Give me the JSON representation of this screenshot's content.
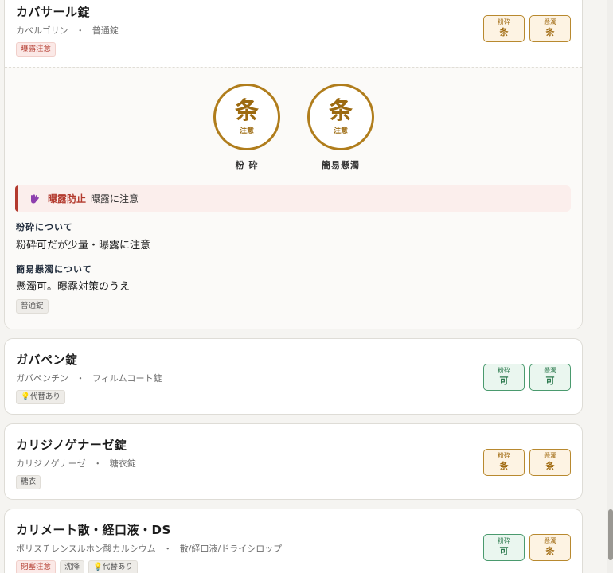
{
  "labels": {
    "crush": "粉砕",
    "suspend": "懸濁"
  },
  "colors": {
    "caution": "#b8892f",
    "ok": "#4a9a6e",
    "alert": "#b33a2e"
  },
  "drugs": [
    {
      "name": "カバサール錠",
      "generic": "カベルゴリン",
      "separator": "・",
      "form": "普通錠",
      "tags": [
        "曝露注意"
      ],
      "crush": "条",
      "suspend": "条",
      "detail": {
        "circles": [
          {
            "symbol": "条",
            "note": "注意",
            "label": "粉 砕"
          },
          {
            "symbol": "条",
            "note": "注意",
            "label": "簡易懸濁"
          }
        ],
        "alert_icon": "glove-icon",
        "alert_key": "曝露防止",
        "alert_text": "曝露に注意",
        "crush_title": "粉砕について",
        "crush_text": "粉砕可だが少量・曝露に注意",
        "suspend_title": "簡易懸濁について",
        "suspend_text": "懸濁可。曝露対策のうえ",
        "form_tag": "普通錠"
      }
    },
    {
      "name": "ガバペン錠",
      "generic": "ガバペンチン",
      "separator": "・",
      "form": "フィルムコート錠",
      "tags": [
        "代替あり"
      ],
      "crush": "可",
      "suspend": "可"
    },
    {
      "name": "カリジノゲナーゼ錠",
      "generic": "カリジノゲナーゼ",
      "separator": "・",
      "form": "糖衣錠",
      "tags": [
        "糖衣"
      ],
      "crush": "条",
      "suspend": "条"
    },
    {
      "name": "カリメート散・経口液・DS",
      "generic": "ポリスチレンスルホン酸カルシウム",
      "separator": "・",
      "form": "散/経口液/ドライシロップ",
      "tags": [
        "閉塞注意",
        "沈降",
        "代替あり"
      ],
      "crush": "可",
      "suspend": "条"
    }
  ]
}
